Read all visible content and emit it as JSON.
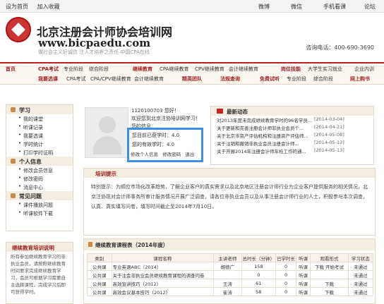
{
  "topbar": {
    "left": [
      "设为首页",
      "加入收藏"
    ],
    "right": [
      "微博",
      "微信",
      "手机看课",
      "论坛"
    ]
  },
  "header": {
    "title": "北京注册会计师协会培训网",
    "url": "www.bicpaedu.com",
    "slogan": "做社会主义好诚信  注人才培养之责任    中国CPA在线",
    "phone": "咨询电话：400-690-3690"
  },
  "nav": {
    "row1": [
      "首页",
      "CPA考试",
      "专业阶段",
      "综合阶段",
      "继续教育",
      "CPA继续教育",
      "CPV继续教育",
      "会计继续教育",
      "岗位技能",
      "大学生实习就业",
      "企业内训"
    ],
    "row2": [
      "我要选课",
      "CPA考试",
      "CPA/CPV继续教育",
      "会计继续教育",
      "精英团队",
      "法规查询",
      "免费试听",
      "专业阶段",
      "综合阶段",
      "网上购书"
    ]
  },
  "sidebar": {
    "section1": {
      "title": "学习",
      "items": [
        "我的课堂",
        "听课记录",
        "我要选课",
        "学时统计",
        "打印学时证明"
      ]
    },
    "section2": {
      "title": "个人信息",
      "items": [
        "修改会员信息",
        "修改密码",
        "消息中心"
      ]
    },
    "section3": {
      "title": "常见问题",
      "items": [
        "课件播放问题",
        "听课软件下载"
      ]
    }
  },
  "notice_left": {
    "title": "继续教育培训说明",
    "text": "所有参加继续教育学习的非执业会员，请按照继续教育时间要求完成继续教育学习，会员可根据学习需要自主选择课程，完成学习后即可获得学时。"
  },
  "user": {
    "line1": "1120100703 您好！",
    "line2": "欢迎您到北京注协培训网学习！",
    "line3": "您的信息："
  },
  "stats": {
    "hours_label": "您目前已获学时：4.0",
    "effective_label": "您的有效学时：4.0",
    "links": [
      "修改个人信息",
      "修改密码",
      "退出"
    ]
  },
  "news": {
    "title": "最新动态",
    "items": [
      {
        "text": "对2013年度未完成继续教育学时的96名学员...",
        "date": "[2014-03-04]"
      },
      {
        "text": "关于更新和完善注册会计师非执业会员个...",
        "date": "[2014-04-21]"
      },
      {
        "text": "关于北京市资产评估机构和注册资产评估师...",
        "date": "[2014-05-08]"
      },
      {
        "text": "关于注销和撤销非执业会员注册会计师...",
        "date": "[2014-05-12]"
      },
      {
        "text": "关于开展2014年注册会计师年检工作的通...",
        "date": "[2014-05-13]"
      }
    ]
  },
  "tips": {
    "title": "培训提示",
    "text": "特别提示：为顺应市场化改革趋势，了解企业客户的真实需求以及北京地区注册会计师行业为企业客户提供服务的相关情况，北京注协现对会计师事务所审计服务情况开展广泛调查，请各位非执业会员以及从事注册会计师行业的人士，积极参与本次调查，认真、真实填写问卷，填写时间截止至2014年7月10日。"
  },
  "course": {
    "title": "继续教育课程表（2014年度）",
    "headers": [
      "类别",
      "课程名称",
      "主讲老师",
      "总时长（分钟）",
      "已学时长",
      "听课",
      "观看形式",
      "学习状态"
    ],
    "rows": [
      [
        "公共课",
        "专业英语ABC（2014）",
        "胡德广",
        "158",
        "0",
        "听课",
        "下载  开始考试",
        "未通过"
      ],
      [
        "公共课",
        "关于注会非执业会员继续教育课程的调查问卷",
        "",
        "0",
        "0",
        "听课",
        "",
        "未通过"
      ],
      [
        "公共课",
        "高效宣讲技巧（2012）",
        "王涛",
        "61",
        "0",
        "听课",
        "下载",
        "未通过"
      ],
      [
        "公共课",
        "高效会议基本技巧（2012）",
        "崔涛",
        "58",
        "0",
        "听课",
        "下载",
        "未通过"
      ]
    ]
  }
}
